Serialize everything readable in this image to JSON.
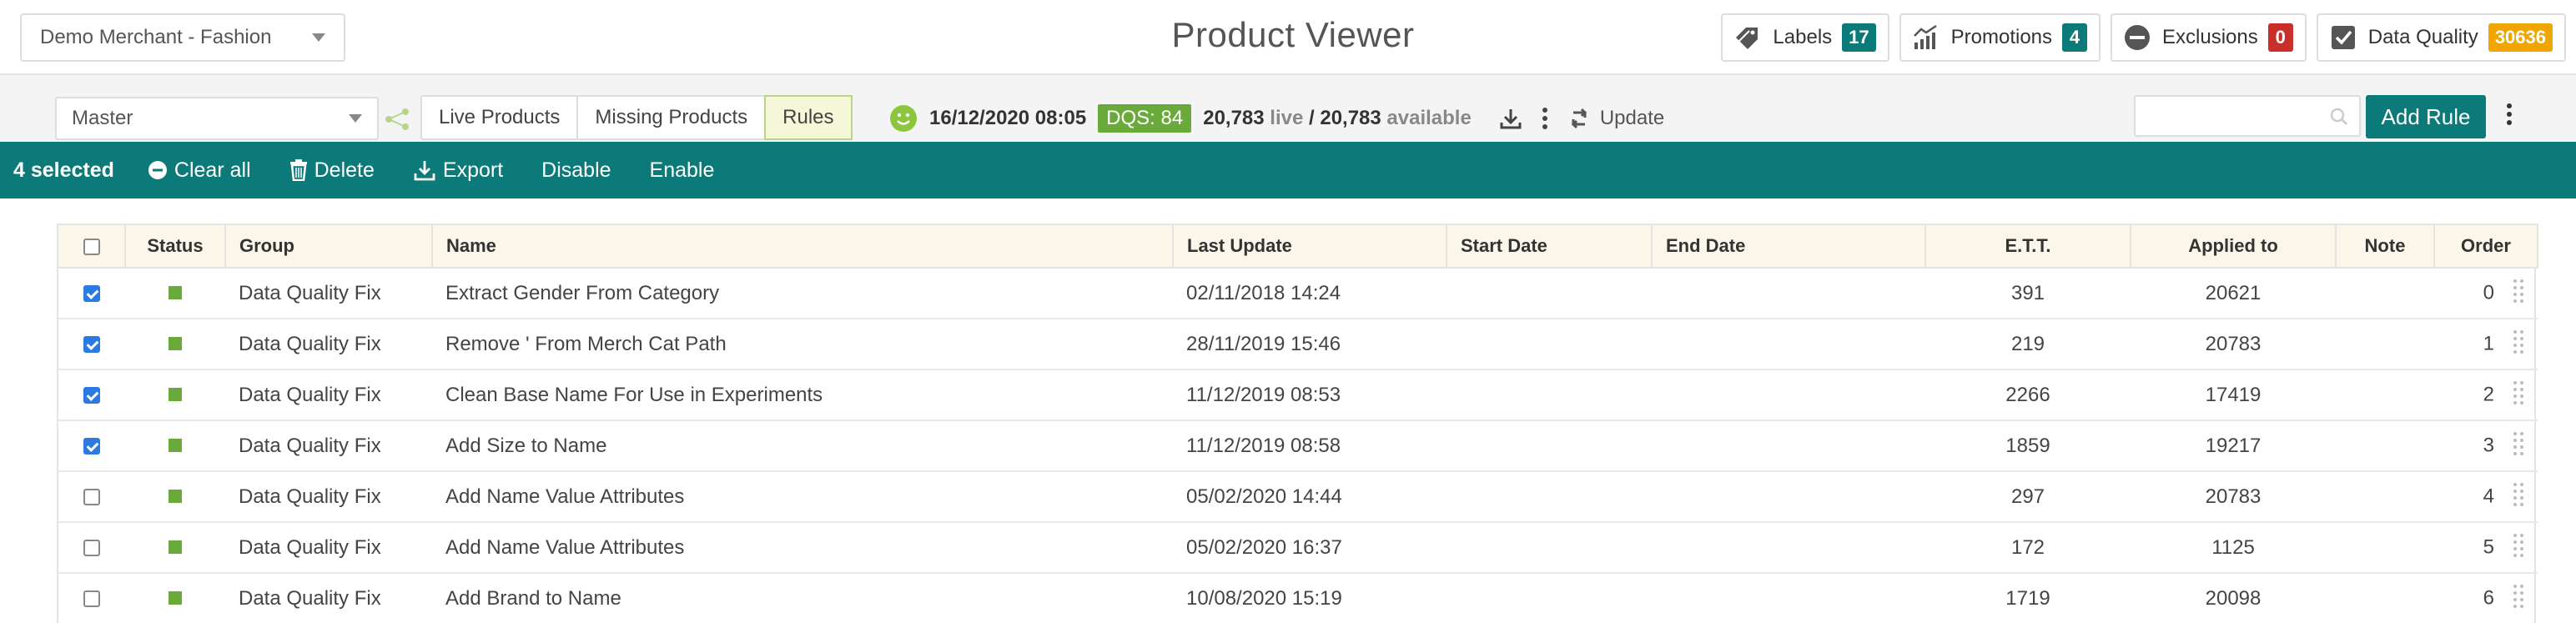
{
  "header": {
    "merchant": "Demo Merchant - Fashion",
    "title": "Product Viewer",
    "badges": [
      {
        "label": "Labels",
        "count": "17",
        "color": "#0b7a78",
        "icon": "tag-icon"
      },
      {
        "label": "Promotions",
        "count": "4",
        "color": "#0b7a78",
        "icon": "chart-icon"
      },
      {
        "label": "Exclusions",
        "count": "0",
        "color": "#c9302c",
        "icon": "minus-circle-icon"
      },
      {
        "label": "Data Quality",
        "count": "30636",
        "color": "#f0a500",
        "icon": "checkbox-icon"
      }
    ]
  },
  "subheader": {
    "view": "Master",
    "tabs": [
      "Live Products",
      "Missing Products",
      "Rules"
    ],
    "active_tab": "Rules",
    "timestamp": "16/12/2020 08:05",
    "dqs": "DQS: 84",
    "live_count": "20,783",
    "live_label": "live",
    "separator": "/",
    "available_count": "20,783",
    "available_label": "available",
    "update_label": "Update",
    "search_placeholder": "",
    "add_rule_label": "Add Rule"
  },
  "selection_bar": {
    "count_label": "4 selected",
    "actions": {
      "clear_all": "Clear all",
      "delete": "Delete",
      "export": "Export",
      "disable": "Disable",
      "enable": "Enable"
    }
  },
  "table": {
    "columns": {
      "status": "Status",
      "group": "Group",
      "name": "Name",
      "last_update": "Last Update",
      "start_date": "Start Date",
      "end_date": "End Date",
      "ett": "E.T.T.",
      "applied_to": "Applied to",
      "note": "Note",
      "order": "Order"
    },
    "rows": [
      {
        "checked": true,
        "group": "Data Quality Fix",
        "name": "Extract Gender From Category",
        "last_update": "02/11/2018 14:24",
        "start_date": "",
        "end_date": "",
        "ett": "391",
        "applied_to": "20621",
        "note": "",
        "order": "0"
      },
      {
        "checked": true,
        "group": "Data Quality Fix",
        "name": "Remove ' From Merch Cat Path",
        "last_update": "28/11/2019 15:46",
        "start_date": "",
        "end_date": "",
        "ett": "219",
        "applied_to": "20783",
        "note": "",
        "order": "1"
      },
      {
        "checked": true,
        "group": "Data Quality Fix",
        "name": "Clean Base Name For Use in Experiments",
        "last_update": "11/12/2019 08:53",
        "start_date": "",
        "end_date": "",
        "ett": "2266",
        "applied_to": "17419",
        "note": "",
        "order": "2"
      },
      {
        "checked": true,
        "group": "Data Quality Fix",
        "name": "Add Size to Name",
        "last_update": "11/12/2019 08:58",
        "start_date": "",
        "end_date": "",
        "ett": "1859",
        "applied_to": "19217",
        "note": "",
        "order": "3"
      },
      {
        "checked": false,
        "group": "Data Quality Fix",
        "name": "Add Name Value Attributes",
        "last_update": "05/02/2020 14:44",
        "start_date": "",
        "end_date": "",
        "ett": "297",
        "applied_to": "20783",
        "note": "",
        "order": "4"
      },
      {
        "checked": false,
        "group": "Data Quality Fix",
        "name": "Add Name Value Attributes",
        "last_update": "05/02/2020 16:37",
        "start_date": "",
        "end_date": "",
        "ett": "172",
        "applied_to": "1125",
        "note": "",
        "order": "5"
      },
      {
        "checked": false,
        "group": "Data Quality Fix",
        "name": "Add Brand to Name",
        "last_update": "10/08/2020 15:19",
        "start_date": "",
        "end_date": "",
        "ett": "1719",
        "applied_to": "20098",
        "note": "",
        "order": "6"
      }
    ]
  },
  "colors": {
    "teal": "#0b7a78",
    "status_green": "#6aaa3a",
    "header_bg": "#faf7ea"
  }
}
